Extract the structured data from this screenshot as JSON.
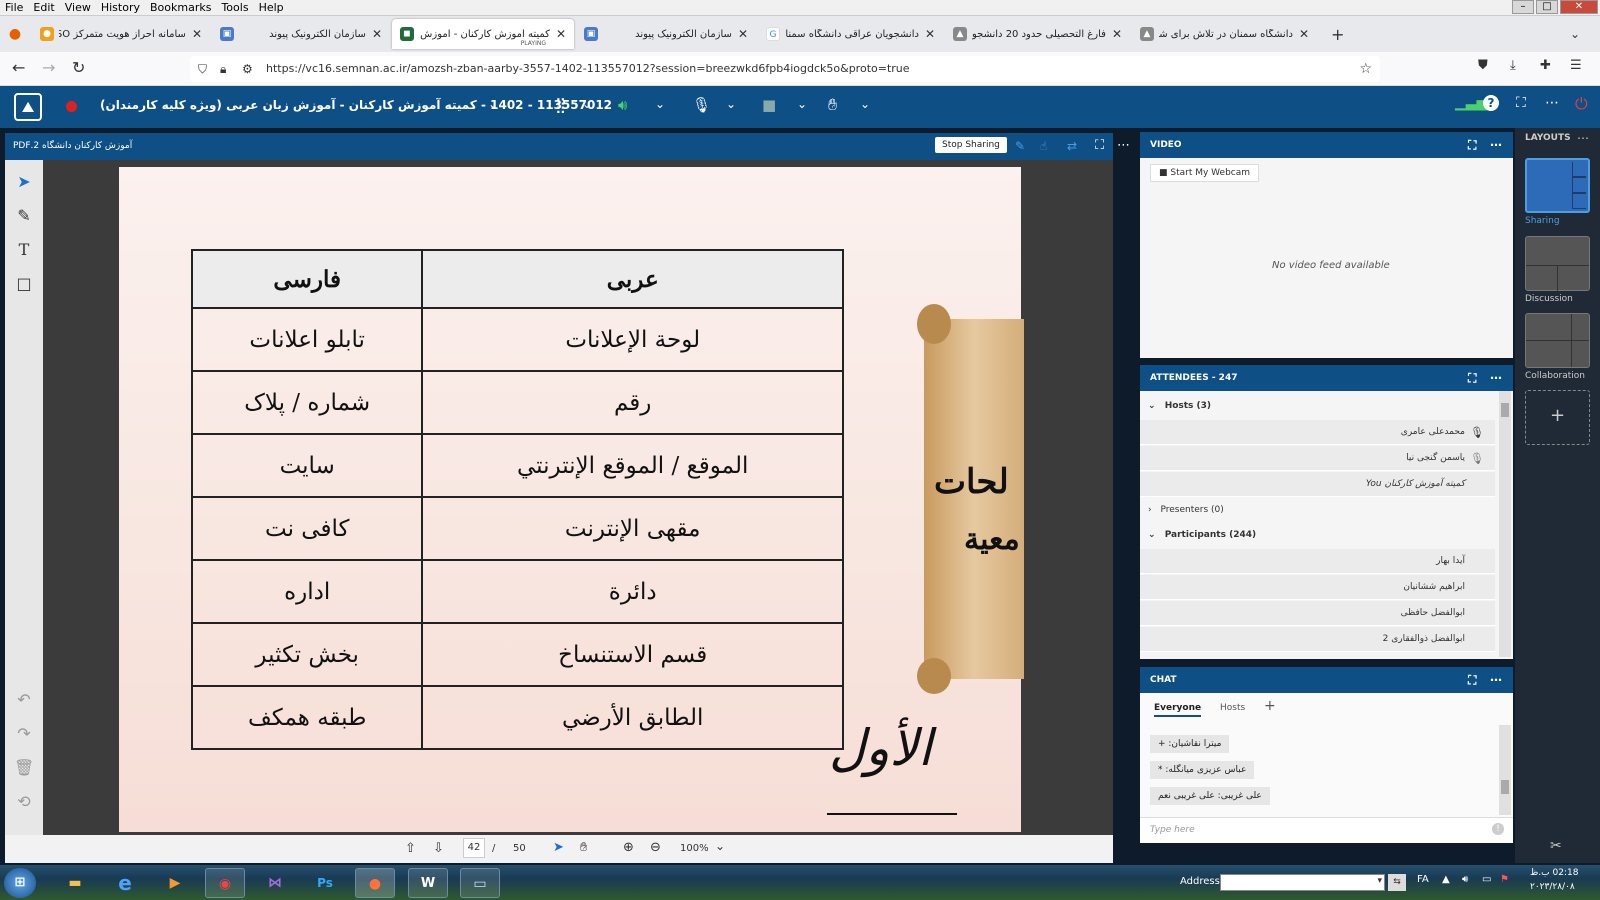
{
  "menubar": {
    "items": [
      "File",
      "Edit",
      "View",
      "History",
      "Bookmarks",
      "Tools",
      "Help"
    ]
  },
  "tabs": [
    {
      "title": "سامانه احراز هویت متمرکز SSO -",
      "active": false
    },
    {
      "title": "سازمان الکترونیک پیوند",
      "active": false
    },
    {
      "title": "کمیته آموزش کارکنان - آموزش زبان",
      "active": true,
      "status": "PLAYING"
    },
    {
      "title": "سازمان الکترونیک پیوند",
      "active": false
    },
    {
      "title": "دانشجویان عراقی دانشگاه سمنان -",
      "active": false
    },
    {
      "title": "فارغ التحصیلی حدود 20 دانشجوی",
      "active": false
    },
    {
      "title": "دانشگاه سمنان در تلاش برای شتاب",
      "active": false
    }
  ],
  "nav": {
    "url": "https://vc16.semnan.ac.ir/amozsh-zban-aarby-3557-1402-113557012?session=breezwkd6fpb4iogdck5o&proto=true"
  },
  "appbar": {
    "title": "113557012 - 1402 - کمیته آموزش کارکنان - آموزش زبان عربی (ویژه کلیه کارمندان)"
  },
  "share": {
    "filename": "آموزش کارکنان دانشگاه 2.PDF",
    "stop_label": "Stop Sharing",
    "table": {
      "headers": [
        "فارسی",
        "عربی"
      ],
      "rows": [
        [
          "تابلو اعلانات",
          "لوحة الإعلانات"
        ],
        [
          "شماره / پلاک",
          "رقم"
        ],
        [
          "سایت",
          "الموقع / الموقع الإنترنتي"
        ],
        [
          "کافی نت",
          "مقهى الإنترنت"
        ],
        [
          "اداره",
          "دائرة"
        ],
        [
          "بخش تکثیر",
          "قسم الاستنساخ"
        ],
        [
          "طبقه همکف",
          "الطابق الأرضي"
        ]
      ]
    },
    "scroll_text_1": "لحات",
    "scroll_text_2": "معية",
    "handwriting": "الأول"
  },
  "pager": {
    "page": "42",
    "sep": "/",
    "total": "50",
    "zoom": "100%"
  },
  "video": {
    "title": "VIDEO",
    "webcam_btn": "Start My Webcam",
    "empty": "No video feed available"
  },
  "attendees": {
    "title": "ATTENDEES - 247",
    "hosts_label": "Hosts (3)",
    "hosts": [
      "محمدعلی عامری",
      "یاسمن گنجی نیا",
      "کمیته آموزش کارکنان You"
    ],
    "presenters_label": "Presenters (0)",
    "participants_label": "Participants (244)",
    "participants": [
      "آیدا بهار",
      "ابراهیم ششانیان",
      "ابوالفضل حافظی",
      "ابوالفضل ذوالفقاری 2"
    ]
  },
  "chat": {
    "title": "CHAT",
    "tabs": [
      "Everyone",
      "Hosts"
    ],
    "messages": [
      "میترا نقاشیان: +",
      "عباس عزیزی میانگله: *",
      "علی غریبی: علی غریبی نعم"
    ],
    "placeholder": "Type here"
  },
  "layouts": {
    "title": "LAYOUTS",
    "items": [
      "Sharing",
      "Discussion",
      "Collaboration"
    ]
  },
  "taskbar": {
    "address_label": "Address",
    "lang": "FA",
    "time": "02:18 ب.ظ",
    "date": "۲۰۲۳/۲۸/۰۸"
  }
}
